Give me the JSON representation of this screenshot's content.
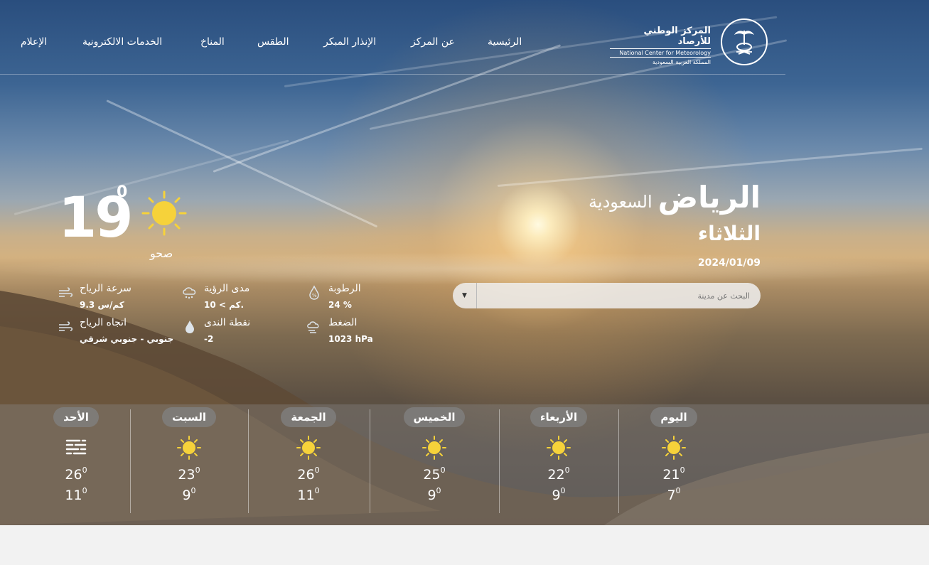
{
  "nav": {
    "items": [
      "الرئيسية",
      "عن المركز",
      "الإنذار المبكر",
      "الطقس",
      "المناخ",
      "الخدمات الالكترونية",
      "الإعلام"
    ]
  },
  "logo": {
    "ar": "المركز الوطني للأرصاد",
    "en": "National Center for Meteorology",
    "sub": "المملكة العربية السعودية"
  },
  "location": {
    "city": "الرياض",
    "country": "السعودية",
    "day": "الثلاثاء",
    "date": "2024/01/09"
  },
  "search": {
    "placeholder": "البحث عن مدينة"
  },
  "current": {
    "temp": "19",
    "unit": "0",
    "condition": "صحو",
    "icon": "sun-icon"
  },
  "stats": {
    "wind_speed": {
      "label": "سرعة الرياح",
      "value": "9.3 كم/س"
    },
    "wind_direction": {
      "label": "اتجاه الرياح",
      "value": "جنوبي - جنوبي شرقي"
    },
    "visibility": {
      "label": "مدى الرؤية",
      "value": "10 < كم."
    },
    "dew_point": {
      "label": "نقطة الندى",
      "value": "-2"
    },
    "humidity": {
      "label": "الرطوبة",
      "value": "24 %"
    },
    "pressure": {
      "label": "الضغط",
      "value": "1023 hPa"
    }
  },
  "forecast": [
    {
      "day": "اليوم",
      "hi": "21",
      "lo": "7",
      "icon": "sun-icon"
    },
    {
      "day": "الأربعاء",
      "hi": "22",
      "lo": "9",
      "icon": "sun-icon"
    },
    {
      "day": "الخميس",
      "hi": "25",
      "lo": "9",
      "icon": "sun-icon"
    },
    {
      "day": "الجمعة",
      "hi": "26",
      "lo": "11",
      "icon": "sun-icon"
    },
    {
      "day": "السبت",
      "hi": "23",
      "lo": "9",
      "icon": "sun-icon"
    },
    {
      "day": "الأحد",
      "hi": "26",
      "lo": "11",
      "icon": "fog-icon"
    }
  ],
  "deg": "0",
  "colors": {
    "sun": "#f6d23a",
    "pill": "#8a8a8a"
  }
}
